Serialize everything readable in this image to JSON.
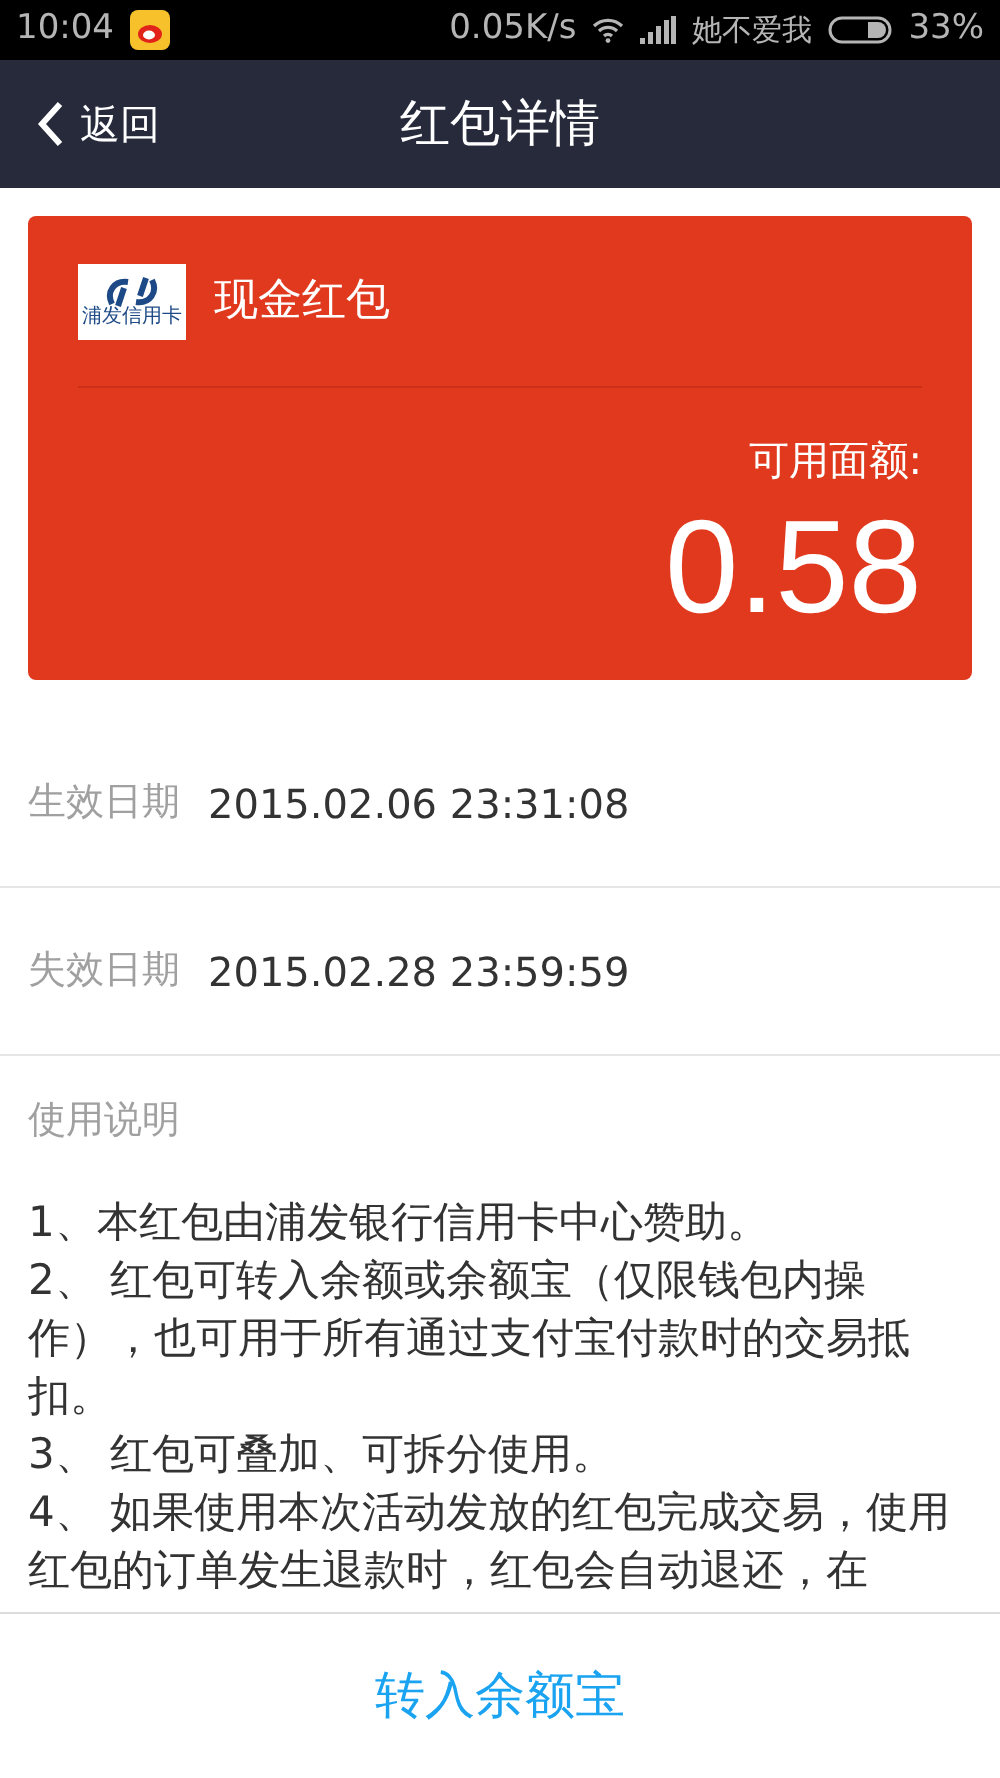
{
  "status_bar": {
    "time": "10:04",
    "speed": "0.05K/s",
    "carrier": "她不爱我",
    "battery": "33%"
  },
  "nav": {
    "back": "返回",
    "title": "红包详情"
  },
  "card": {
    "name": "现金红包",
    "logo_text": "浦发信用卡",
    "amount_label": "可用面额:",
    "amount": "0.58"
  },
  "fields": [
    {
      "label": "生效日期",
      "value": "2015.02.06 23:31:08"
    },
    {
      "label": "失效日期",
      "value": "2015.02.28 23:59:59"
    }
  ],
  "instructions": {
    "title": "使用说明",
    "items": [
      "1、本红包由浦发银行信用卡中心赞助。",
      "2、 红包可转入余额或余额宝（仅限钱包内操作），也可用于所有通过支付宝付款时的交易抵扣。",
      "3、 红包可叠加、可拆分使用。",
      "4、 如果使用本次活动发放的红包完成交易，使用红包的订单发生退款时，红包会自动退还，在"
    ]
  },
  "action": "转入余额宝"
}
